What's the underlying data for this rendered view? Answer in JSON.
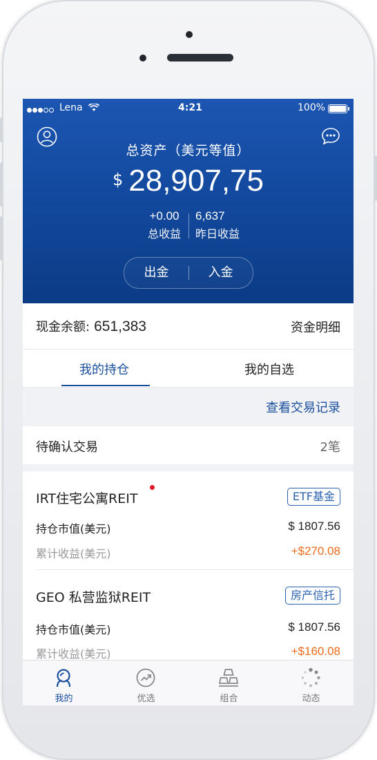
{
  "status_bar": {
    "carrier": "Lena",
    "time": "4:21",
    "battery": "100%"
  },
  "header": {
    "title": "总资产（美元等值）",
    "currency_symbol": "$",
    "total_assets": "28,907,75",
    "total_profit_value": "+0.00",
    "total_profit_label": "总收益",
    "yesterday_profit_value": "6,637",
    "yesterday_profit_label": "昨日收益",
    "withdraw_label": "出金",
    "deposit_label": "入金"
  },
  "cash": {
    "label": "现金余额:",
    "value": "651,383",
    "detail_link": "资金明细"
  },
  "tabs": [
    {
      "label": "我的持仓",
      "active": true
    },
    {
      "label": "我的自选",
      "active": false
    }
  ],
  "record_link": "查看交易记录",
  "pending": {
    "label": "待确认交易",
    "count": "2笔"
  },
  "holdings": [
    {
      "name": "IRT住宅公寓REIT",
      "tag": "ETF基金",
      "unread": true,
      "market_value_label": "持仓市值(美元)",
      "market_value": "$ 1807.56",
      "cum_profit_label": "累计收益(美元)",
      "cum_profit": "+$270.08"
    },
    {
      "name": "GEO 私营监狱REIT",
      "tag": "房产信托",
      "unread": false,
      "market_value_label": "持仓市值(美元)",
      "market_value": "$ 1807.56",
      "cum_profit_label": "累计收益(美元)",
      "cum_profit": "+$160.08"
    }
  ],
  "tabbar": [
    {
      "label": "我的",
      "icon": "person-icon",
      "active": true
    },
    {
      "label": "优选",
      "icon": "trend-icon",
      "active": false
    },
    {
      "label": "组合",
      "icon": "stack-icon",
      "active": false
    },
    {
      "label": "动态",
      "icon": "spinner-icon",
      "active": false
    }
  ],
  "colors": {
    "primary": "#1a4f9e",
    "header_top": "#1c56b2",
    "header_bottom": "#0b3b86",
    "profit": "#ef6a1a",
    "unread_dot": "#e21b23"
  }
}
